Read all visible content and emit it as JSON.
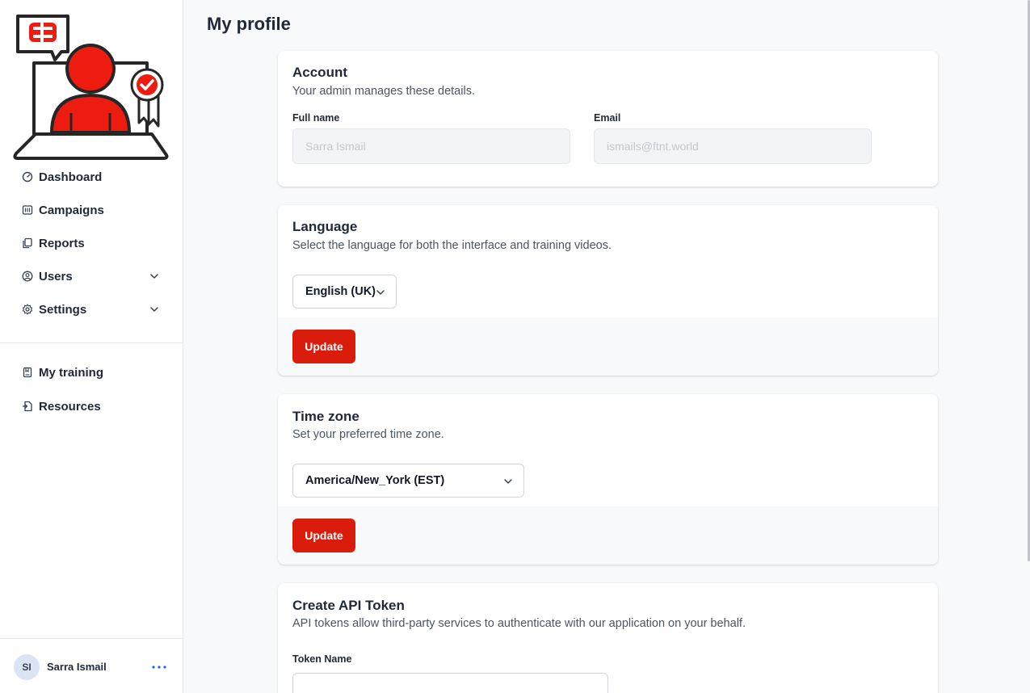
{
  "page": {
    "title": "My profile"
  },
  "sidebar": {
    "logo_icon": "awareness-trainer-logo",
    "items": [
      {
        "label": "Dashboard",
        "icon": "dashboard-gauge-icon"
      },
      {
        "label": "Campaigns",
        "icon": "campaigns-icon"
      },
      {
        "label": "Reports",
        "icon": "reports-icon"
      },
      {
        "label": "Users",
        "icon": "users-icon",
        "expandable": true
      },
      {
        "label": "Settings",
        "icon": "gear-icon",
        "expandable": true
      },
      {
        "label": "My training",
        "icon": "training-book-icon"
      },
      {
        "label": "Resources",
        "icon": "resources-icon"
      }
    ],
    "user": {
      "initials": "SI",
      "name": "Sarra Ismail"
    }
  },
  "account": {
    "title": "Account",
    "description": "Your admin manages these details.",
    "full_name_label": "Full name",
    "full_name_value": "Sarra Ismail",
    "email_label": "Email",
    "email_value": "ismails@ftnt.world"
  },
  "language": {
    "title": "Language",
    "description": "Select the language for both the interface and training videos.",
    "selected": "English (UK)",
    "button": "Update"
  },
  "timezone": {
    "title": "Time zone",
    "description": "Set your preferred time zone.",
    "selected": "America/New_York (EST)",
    "button": "Update"
  },
  "api_token": {
    "title": "Create API Token",
    "description": "API tokens allow third-party services to authenticate with our application on your behalf.",
    "token_name_label": "Token Name",
    "token_name_value": ""
  },
  "colors": {
    "accent": "#da1c0c",
    "logo_red": "#ee1c10",
    "outline": "#262626"
  }
}
